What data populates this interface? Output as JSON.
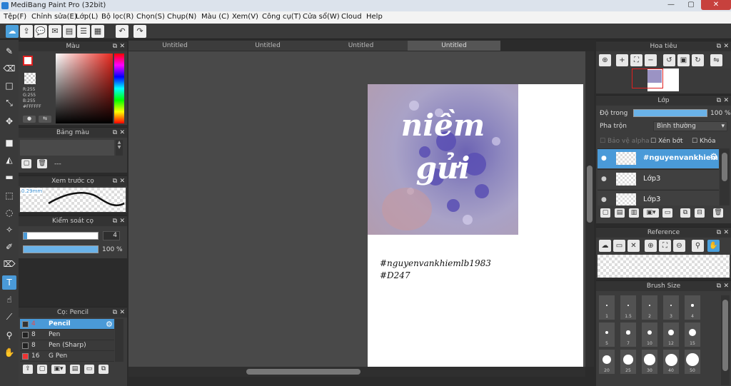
{
  "app": {
    "title": "MediBang Paint Pro (32bit)"
  },
  "window_buttons": {
    "minimize": "—",
    "maximize": "▢",
    "close": "✕"
  },
  "menu": [
    "Tệp(F)",
    "Chỉnh sửa(E)",
    "Lớp(L)",
    "Bộ lọc(R)",
    "Chọn(S)",
    "Chụp(N)",
    "Màu (C)",
    "Xem(V)",
    "Công cụ(T)",
    "Cửa sổ(W)",
    "Cloud",
    "Help"
  ],
  "tabs": [
    "Untitled",
    "Untitled",
    "Untitled",
    "Untitled"
  ],
  "color_panel": {
    "title": "Màu",
    "r": "R:255",
    "g": "G:255",
    "b": "B:255",
    "hex": "#FFFFFF",
    "colors": {
      "fg": "#ffffff",
      "hue_base": "#e8281e",
      "accent": "#4a9ad8"
    }
  },
  "palette_panel": {
    "title": "Bảng màu",
    "value": "---"
  },
  "brush_preview": {
    "title": "Xem trước cọ",
    "size": "0.29mm"
  },
  "brush_control": {
    "title": "Kiểm soát cọ",
    "size": "4",
    "opacity": "100 %",
    "size_level": 1.0,
    "opacity_level": 1.0
  },
  "brush_list": {
    "title": "Cọ: Pencil",
    "items": [
      {
        "size": "4",
        "name": "Pencil",
        "active": true
      },
      {
        "size": "8",
        "name": "Pen",
        "active": false
      },
      {
        "size": "8",
        "name": "Pen (Sharp)",
        "active": false
      },
      {
        "size": "16",
        "name": "G Pen",
        "active": false
      }
    ]
  },
  "navigator": {
    "title": "Hoa tiêu"
  },
  "layers": {
    "title": "Lớp",
    "opacity_label": "Độ trong",
    "opacity_value": "100 %",
    "blend_label": "Pha trộn",
    "blend_value": "Bình thường",
    "protect_alpha": "Bảo vệ alpha",
    "clipping": "Xén bớt",
    "lock": "Khóa",
    "items": [
      {
        "name": "#nguyenvankhiem",
        "active": true
      },
      {
        "name": "Lớp3",
        "active": false
      },
      {
        "name": "Lớp3",
        "active": false
      }
    ]
  },
  "reference": {
    "title": "Reference"
  },
  "brush_size": {
    "title": "Brush Size",
    "rows": [
      [
        "1",
        "1.5",
        "2",
        "3",
        "4"
      ],
      [
        "5",
        "7",
        "10",
        "12",
        "15"
      ],
      [
        "20",
        "25",
        "30",
        "40",
        "50"
      ]
    ]
  },
  "artwork": {
    "title_line1": "niềm",
    "title_line2": "gửi",
    "caption_line1": "#nguyenvankhiemlb1983",
    "caption_line2": "#D247"
  }
}
